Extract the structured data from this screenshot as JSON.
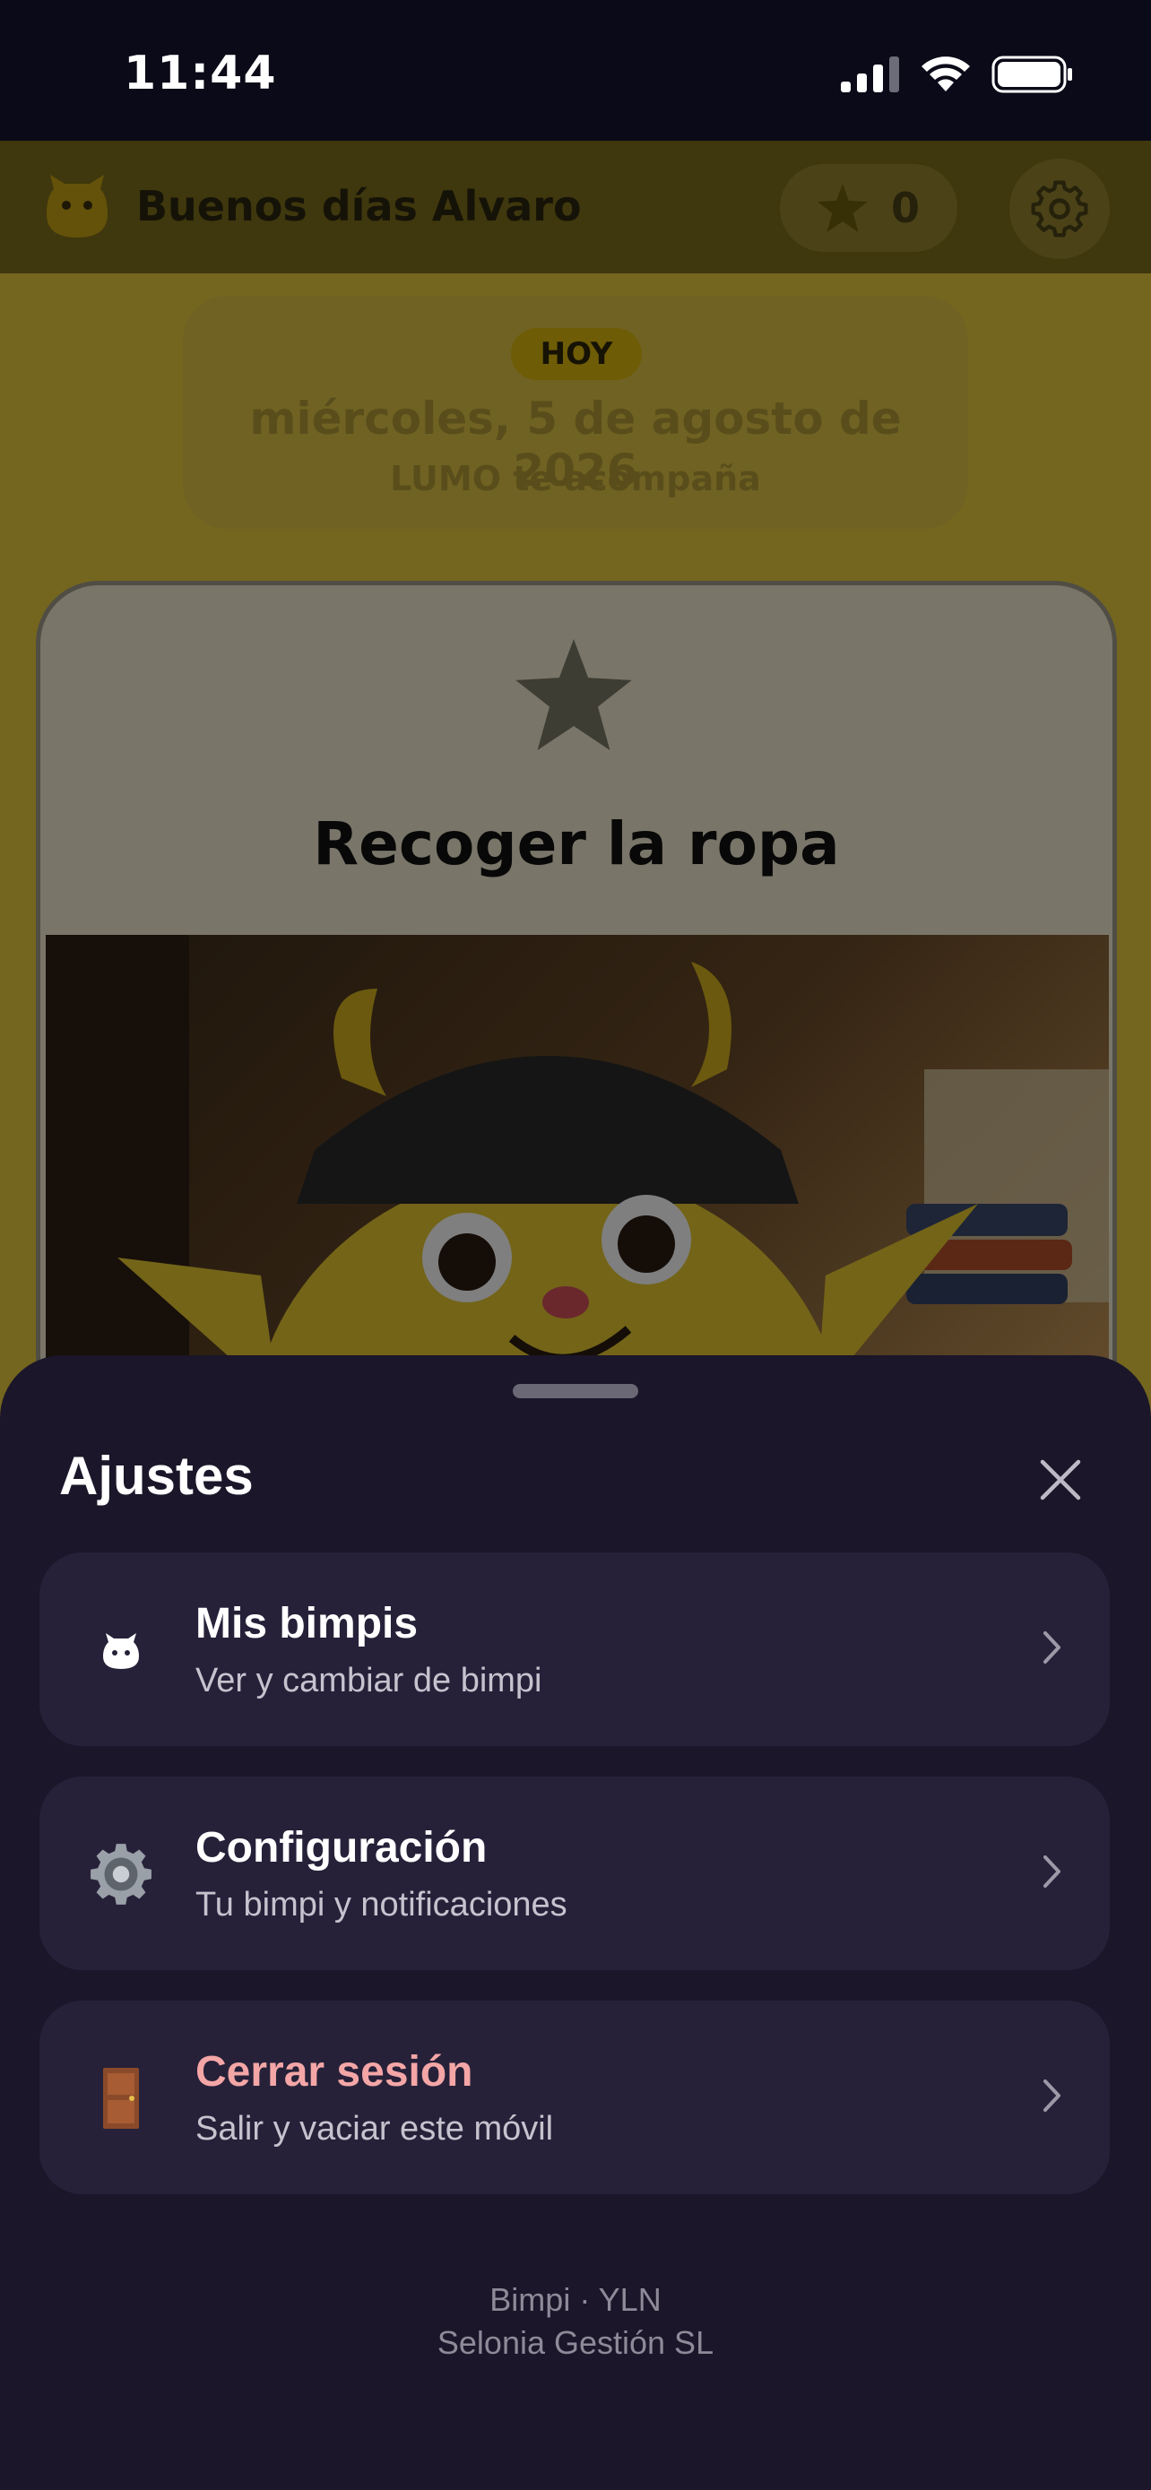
{
  "status_bar": {
    "time": "11:44",
    "icons": [
      "cellular-signal-icon",
      "wifi-icon",
      "battery-icon"
    ]
  },
  "header": {
    "logo_icon": "bimpi-logo-icon",
    "greeting": "Buenos días Alvaro",
    "stars_count": "0",
    "settings_icon": "gear-icon"
  },
  "today": {
    "badge": "HOY",
    "date": "miércoles, 5 de agosto de 2026",
    "subtitle": "LUMO te acompaña"
  },
  "task": {
    "title": "Recoger la ropa",
    "image_alt": "bimpi character in bedroom"
  },
  "settings_sheet": {
    "title": "Ajustes",
    "items": [
      {
        "label": "Mis bimpis",
        "subtitle": "Ver y cambiar de bimpi",
        "icon": "bimpi-icon"
      },
      {
        "label": "Configuración",
        "subtitle": "Tu bimpi y notificaciones",
        "icon": "gear-icon"
      },
      {
        "label": "Cerrar sesión",
        "subtitle": "Salir y vaciar este móvil",
        "icon": "door-icon"
      }
    ],
    "footer_line1": "Bimpi · YLN",
    "footer_line2": "Selonia Gestión SL"
  },
  "colors": {
    "accent_yellow": "#e8cc3c",
    "sheet_bg": "#1b1629",
    "row_bg": "#262139",
    "danger_label": "#f4a6a6"
  }
}
